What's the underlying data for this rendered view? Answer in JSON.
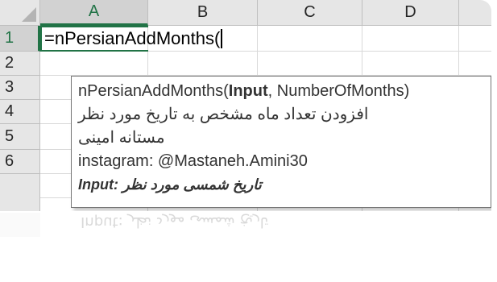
{
  "columns": [
    "A",
    "B",
    "C",
    "D"
  ],
  "rows": [
    "1",
    "2",
    "3",
    "4",
    "5",
    "6"
  ],
  "active_cell": "A1",
  "formula_text": "=nPersianAddMonths(",
  "tooltip": {
    "signature_fn": "nPersianAddMonths(",
    "signature_arg_bold": "Input",
    "signature_rest": ", NumberOfMonths)",
    "description": "افزودن تعداد ماه مشخص به تاریخ مورد نظر",
    "author": "مستانه امینی",
    "contact": "instagram: @Mastaneh.Amini30",
    "arg_help": "تاریخ شمسی مورد نظر :Input"
  },
  "reflection": {
    "row_label": "6",
    "text": "Input: تاریخ شمسی مورد نظر"
  },
  "colors": {
    "accent_green": "#217346",
    "header_bg": "#e6e6e6",
    "gridline": "#d9d9d9"
  }
}
